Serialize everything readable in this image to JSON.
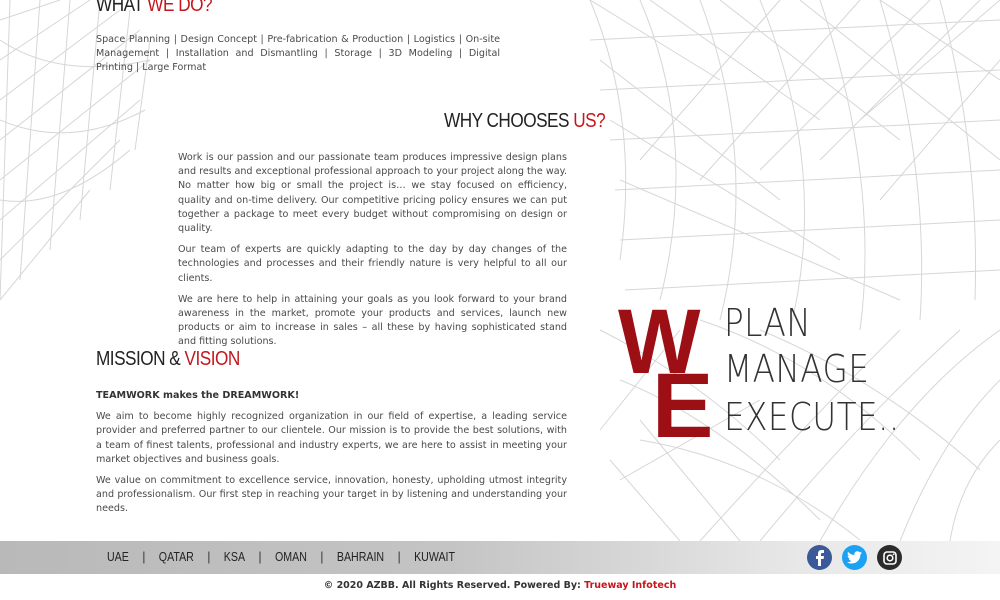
{
  "what_we_do": {
    "heading_main": "WHAT ",
    "heading_accent": "WE DO?",
    "services": "Space Planning | Design Concept | Pre-fabrication & Production | Logistics | On-site Management | Installation and Dismantling | Storage | 3D Modeling | Digital Printing | Large Format"
  },
  "why_choose": {
    "heading_main": "WHY CHOOSES ",
    "heading_accent": "US?",
    "paragraphs": [
      "Work is our passion and our passionate team produces impressive design plans and results and exceptional professional approach to your project along the way. No matter how big or small the project is… we stay focused on efficiency, quality and on-time delivery. Our competitive pricing policy ensures we can put together a package to meet every budget without compromising on design or quality.",
      "Our team of experts are quickly adapting to the day by day changes of the technologies and processes and their friendly nature is very helpful to all our clients.",
      "We are here to help in attaining your goals as you look forward to your brand awareness in the market, promote your products and services, launch new products or aim to increase in sales – all these by having sophisticated stand and fitting solutions."
    ]
  },
  "mission": {
    "heading_main": "MISSION & ",
    "heading_accent": "VISION",
    "tagline": "TEAMWORK makes the DREAMWORK!",
    "paragraphs": [
      "We aim to become highly recognized organization in our field of expertise, a leading service provider and preferred partner to our clientele. Our mission is to provide the best solutions, with a team of finest talents, professional and industry experts, we are here to assist in meeting your market objectives and business goals.",
      "We value on commitment to excellence service, innovation, honesty, upholding utmost integrity and professionalism. Our first step in reaching your target in by listening and understanding your needs."
    ]
  },
  "we_logo": {
    "letter_w": "W",
    "letter_e": "E",
    "words": [
      "PLAN",
      "MANAGE",
      "EXECUTE.."
    ],
    "accent_color": "#9b0f15"
  },
  "footer": {
    "countries": [
      "UAE",
      "QATAR",
      "KSA",
      "OMAN",
      "BAHRAIN",
      "KUWAIT"
    ],
    "separator": "|",
    "social": [
      {
        "name": "facebook-icon",
        "color": "#3b5998"
      },
      {
        "name": "twitter-icon",
        "color": "#1da1f2"
      },
      {
        "name": "instagram-icon",
        "color": "#2b2b2b"
      }
    ],
    "copyright_text": "© 2020 AZBB. All Rights Reserved. Powered By: ",
    "powered_by_link": "Trueway Infotech"
  },
  "colors": {
    "accent": "#c4161c",
    "heading": "#222222",
    "body_text": "#4a4a4a"
  }
}
